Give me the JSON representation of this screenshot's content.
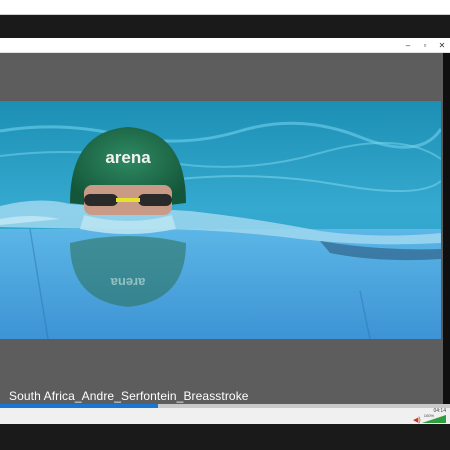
{
  "window": {
    "min_glyph": "–",
    "max_glyph": "▫",
    "close_glyph": "✕"
  },
  "video": {
    "cap_text": "arena",
    "caption": "South Africa_Andre_Serfontein_Breasstroke"
  },
  "player": {
    "progress_fraction": 0.35,
    "time": "04:14",
    "volume_percent": "100%",
    "speaker_glyph": "◀)"
  },
  "colors": {
    "progress": "#1976d2",
    "volume": "#2e9e3e"
  },
  "icons": [
    "minimize-icon",
    "maximize-icon",
    "close-icon",
    "speaker-icon"
  ]
}
